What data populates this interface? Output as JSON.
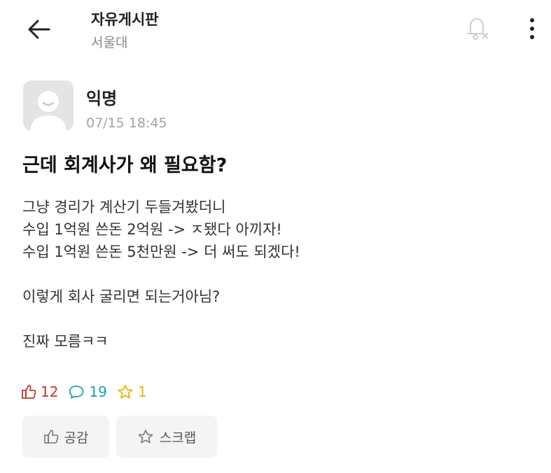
{
  "header": {
    "board_title": "자유게시판",
    "board_subtitle": "서울대"
  },
  "post": {
    "author": "익명",
    "time": "07/15 18:45",
    "title": "근데 회계사가 왜 필요함?",
    "body_lines": [
      "그냥 경리가 계산기 두들겨봤더니",
      "수입 1억원 쓴돈 2억원 -> ㅈ됐다 아끼자!",
      "수입 1억원 쓴돈 5천만원 -> 더 써도 되겠다!",
      "",
      "이렇게 회사 굴리면 되는거아님?",
      "",
      "진짜 모름ㅋㅋ"
    ]
  },
  "stats": {
    "likes": "12",
    "comments": "19",
    "scraps": "1"
  },
  "actions": {
    "like_label": "공감",
    "scrap_label": "스크랩"
  },
  "colors": {
    "like": "#c0392b",
    "comment": "#1aa3b8",
    "scrap": "#e8b400"
  },
  "icons": [
    "back-arrow-icon",
    "bell-off-icon",
    "more-vertical-icon",
    "thumbs-up-icon",
    "comment-icon",
    "star-icon"
  ]
}
